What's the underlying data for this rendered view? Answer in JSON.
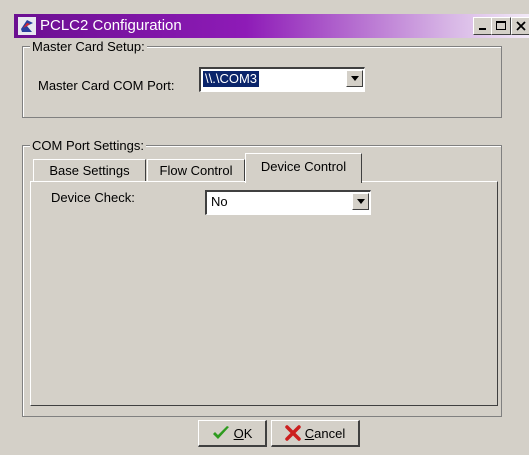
{
  "window": {
    "title": "PCLC2 Configuration",
    "icon": "pclc-app-icon",
    "controls": [
      "minimize-icon",
      "maximize-icon",
      "close-icon"
    ]
  },
  "master_group": {
    "legend": "Master Card Setup:",
    "com_port_label": "Master Card COM Port:",
    "com_port_value": "\\\\.\\COM3"
  },
  "com_group": {
    "legend": "COM Port Settings:",
    "tabs": [
      {
        "label": "Base Settings",
        "active": false
      },
      {
        "label": "Flow Control",
        "active": false
      },
      {
        "label": "Device Control",
        "active": true
      }
    ],
    "device_check_label": "Device Check:",
    "device_check_value": "No"
  },
  "buttons": {
    "ok": {
      "mnemonic": "O",
      "rest": "K",
      "icon": "checkmark-icon"
    },
    "cancel": {
      "mnemonic": "C",
      "rest": "ancel",
      "icon": "x-icon"
    }
  },
  "colors": {
    "title_gradient_start": "#6b0f91",
    "face": "#d4d0c8",
    "selection": "#0a246a",
    "ok_icon": "#2e9b1f",
    "cancel_icon": "#cc1f1f"
  }
}
